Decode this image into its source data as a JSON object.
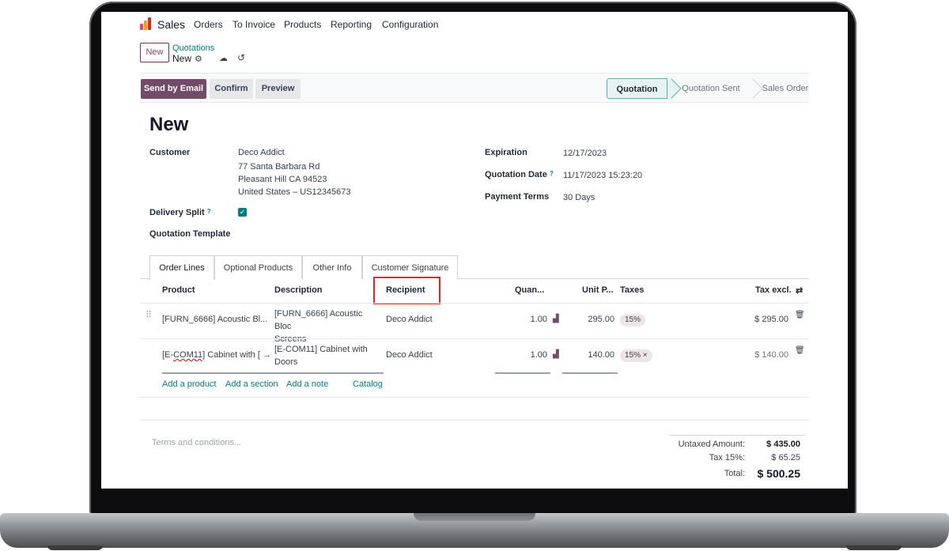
{
  "nav": {
    "brand": "Sales",
    "items": [
      "Orders",
      "To Invoice",
      "Products",
      "Reporting",
      "Configuration"
    ]
  },
  "control": {
    "new_button": "New",
    "breadcrumb_parent": "Quotations",
    "breadcrumb_current": "New"
  },
  "toolbar": {
    "send_email": "Send by Email",
    "confirm": "Confirm",
    "preview": "Preview"
  },
  "status": {
    "stages": [
      "Quotation",
      "Quotation Sent",
      "Sales Order"
    ],
    "active": "Quotation"
  },
  "form": {
    "title": "New",
    "customer_label": "Customer",
    "customer_lines": [
      "Deco Addict",
      "77 Santa Barbara Rd",
      "Pleasant Hill CA 94523",
      "United States – US12345673"
    ],
    "delivery_split_label": "Delivery Split",
    "delivery_split_checked": true,
    "template_label": "Quotation Template",
    "expiration_label": "Expiration",
    "expiration_value": "12/17/2023",
    "quotation_date_label": "Quotation Date",
    "quotation_date_value": "11/17/2023 15:23:20",
    "payment_terms_label": "Payment Terms",
    "payment_terms_value": "30 Days",
    "help_mark": "?"
  },
  "tabs": [
    "Order Lines",
    "Optional Products",
    "Other Info",
    "Customer Signature"
  ],
  "table": {
    "headers": {
      "product": "Product",
      "description": "Description",
      "recipient": "Recipient",
      "quantity": "Quan...",
      "unit_price": "Unit P...",
      "taxes": "Taxes",
      "tax_excl": "Tax excl."
    },
    "rows": [
      {
        "product": "[FURN_6666] Acoustic Bl...",
        "description_1": "[FURN_6666] Acoustic Bloc",
        "description_2": "Screens",
        "recipient": "Deco Addict",
        "quantity": "1.00",
        "unit_price": "295.00",
        "tax": "15%",
        "subtotal": "$ 295.00"
      },
      {
        "product_prefix": "[E-",
        "product_spell": "COM11",
        "product_suffix": "] Cabinet with [",
        "description_1": "[E-COM11] Cabinet with",
        "description_2": "Doors",
        "recipient": "Deco Addict",
        "quantity": "1.00",
        "unit_price": "140.00",
        "tax": "15% ×",
        "subtotal": "$ 140.00"
      }
    ],
    "add_product": "Add a product",
    "add_section": "Add a section",
    "add_note": "Add a note",
    "catalog": "Catalog"
  },
  "footer": {
    "terms_placeholder": "Terms and conditions...",
    "untaxed_label": "Untaxed Amount:",
    "untaxed_value": "$ 435.00",
    "tax_label": "Tax 15%:",
    "tax_value": "$ 65.25",
    "total_label": "Total:",
    "total_value": "$ 500.25"
  },
  "colors": {
    "brand": "#714b67",
    "accent": "#017e84",
    "highlight_box": "#e32626"
  }
}
